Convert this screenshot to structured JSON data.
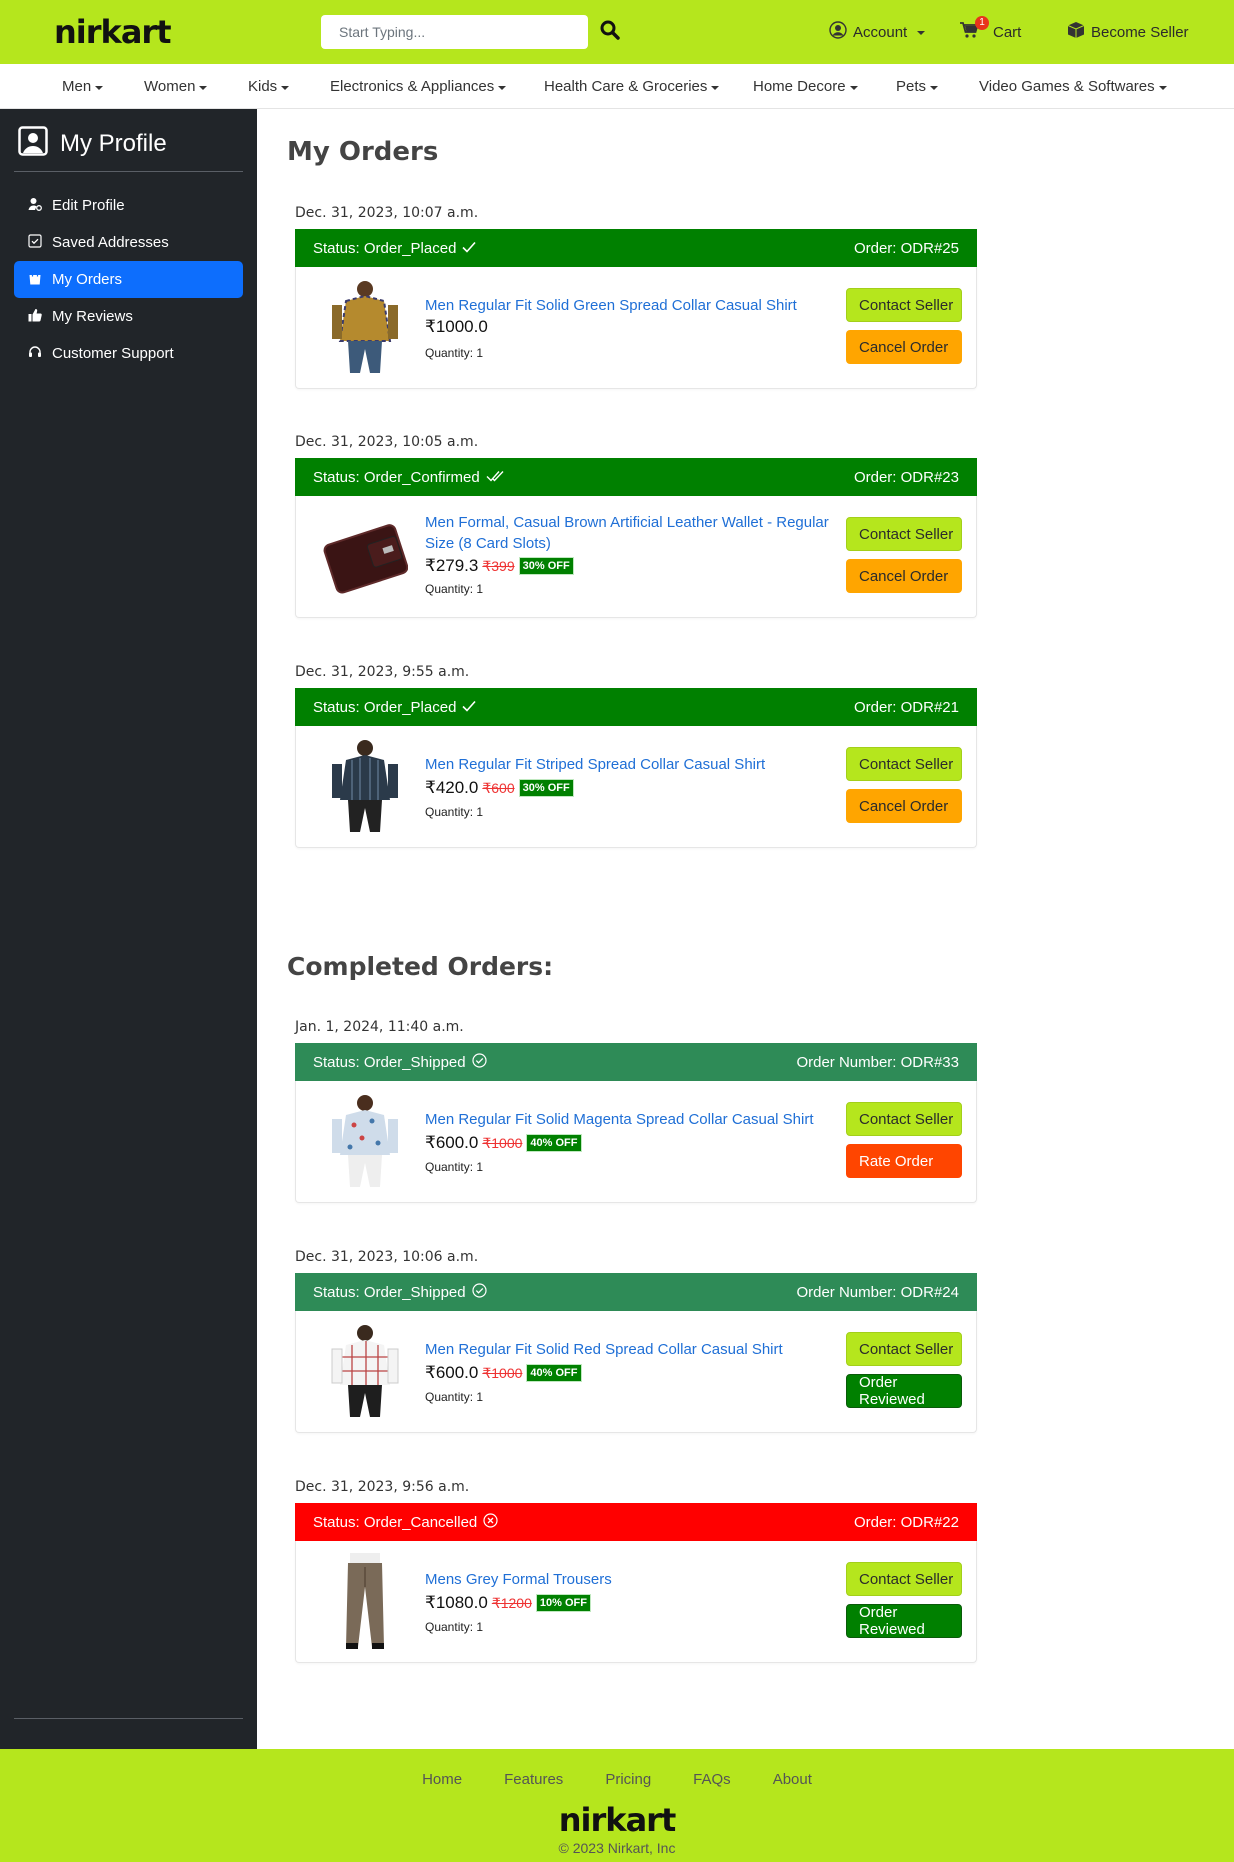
{
  "header": {
    "logo": "nirkart",
    "search_placeholder": "Start Typing...",
    "account_label": "Account",
    "cart_label": "Cart",
    "cart_count": "1",
    "seller_label": "Become Seller"
  },
  "categories": [
    "Men",
    "Women",
    "Kids",
    "Electronics & Appliances",
    "Health Care & Groceries",
    "Home Decore",
    "Pets",
    "Video Games & Softwares"
  ],
  "sidebar": {
    "title": "My Profile",
    "items": [
      {
        "label": "Edit Profile",
        "icon": "user-edit-icon"
      },
      {
        "label": "Saved Addresses",
        "icon": "address-check-icon"
      },
      {
        "label": "My Orders",
        "icon": "shopping-bag-icon",
        "active": true
      },
      {
        "label": "My Reviews",
        "icon": "thumbs-up-icon"
      },
      {
        "label": "Customer Support",
        "icon": "headset-icon"
      }
    ]
  },
  "main": {
    "title": "My Orders",
    "completed_title": "Completed Orders:"
  },
  "orders": [
    {
      "date": "Dec. 31, 2023, 10:07 a.m.",
      "status": "Status: Order_Placed",
      "order_no": "Order: ODR#25",
      "product": "Men Regular Fit Solid Green Spread Collar Casual Shirt",
      "price": "₹1000.0",
      "mrp": "",
      "discount": "",
      "quantity": "Quantity: 1",
      "btn1": "Contact Seller",
      "btn2": "Cancel Order"
    },
    {
      "date": "Dec. 31, 2023, 10:05 a.m.",
      "status": "Status: Order_Confirmed",
      "order_no": "Order: ODR#23",
      "product": "Men Formal, Casual Brown Artificial Leather Wallet - Regular Size (8 Card Slots)",
      "price": "₹279.3",
      "mrp": "₹399",
      "discount": "30% OFF",
      "quantity": "Quantity: 1",
      "btn1": "Contact Seller",
      "btn2": "Cancel Order"
    },
    {
      "date": "Dec. 31, 2023, 9:55 a.m.",
      "status": "Status: Order_Placed",
      "order_no": "Order: ODR#21",
      "product": "Men Regular Fit Striped Spread Collar Casual Shirt",
      "price": "₹420.0",
      "mrp": "₹600",
      "discount": "30% OFF",
      "quantity": "Quantity: 1",
      "btn1": "Contact Seller",
      "btn2": "Cancel Order"
    }
  ],
  "completed": [
    {
      "date": "Jan. 1, 2024, 11:40 a.m.",
      "status": "Status: Order_Shipped",
      "order_no": "Order Number: ODR#33",
      "product": "Men Regular Fit Solid Magenta Spread Collar Casual Shirt",
      "price": "₹600.0",
      "mrp": "₹1000",
      "discount": "40% OFF",
      "quantity": "Quantity: 1",
      "btn1": "Contact Seller",
      "btn2": "Rate Order"
    },
    {
      "date": "Dec. 31, 2023, 10:06 a.m.",
      "status": "Status: Order_Shipped",
      "order_no": "Order Number: ODR#24",
      "product": "Men Regular Fit Solid Red Spread Collar Casual Shirt",
      "price": "₹600.0",
      "mrp": "₹1000",
      "discount": "40% OFF",
      "quantity": "Quantity: 1",
      "btn1": "Contact Seller",
      "btn2": "Order Reviewed"
    },
    {
      "date": "Dec. 31, 2023, 9:56 a.m.",
      "status": "Status: Order_Cancelled",
      "order_no": "Order: ODR#22",
      "product": "Mens Grey Formal Trousers",
      "price": "₹1080.0",
      "mrp": "₹1200",
      "discount": "10% OFF",
      "quantity": "Quantity: 1",
      "btn1": "Contact Seller",
      "btn2": "Order Reviewed"
    }
  ],
  "footer": {
    "links": [
      "Home",
      "Features",
      "Pricing",
      "FAQs",
      "About"
    ],
    "logo": "nirkart",
    "copyright": "© 2023 Nirkart, Inc"
  },
  "colors": {
    "brand": "#b5e61d",
    "sidebar": "#212529",
    "active": "#0d6efd",
    "status_green": "#008000",
    "status_shipped": "#2e8b57",
    "status_cancelled": "#ff0000",
    "cancel_btn": "#ffa500",
    "rate_btn": "#ff4500"
  }
}
